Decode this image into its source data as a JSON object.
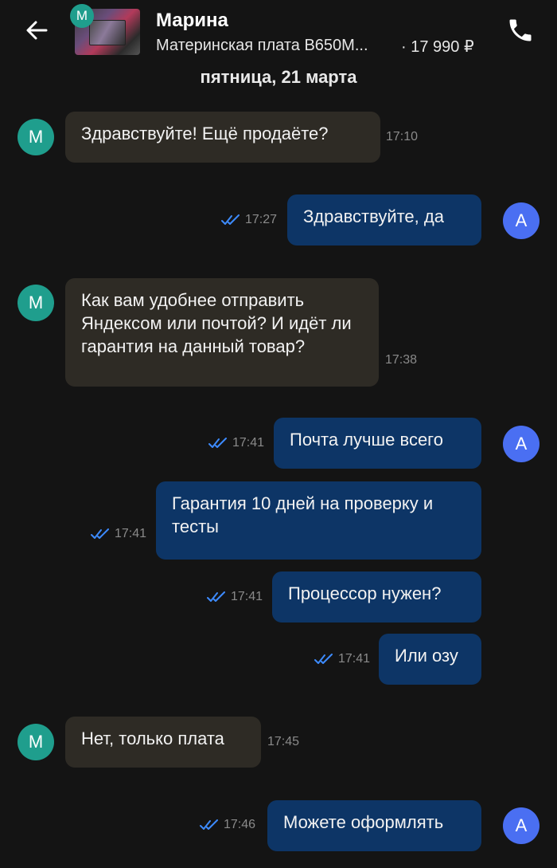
{
  "header": {
    "contact_name": "Марина",
    "contact_initial": "М",
    "product_title": "Материнская плата B650M...",
    "price": "· 17 990 ₽"
  },
  "date_separator": "пятница, 21 марта",
  "colors": {
    "background": "#141414",
    "incoming_bubble": "#2e2b25",
    "outgoing_bubble": "#0d3566",
    "avatar_contact": "#1f9e8d",
    "avatar_self": "#4a6ff2",
    "read_ticks": "#3d8bff"
  },
  "self_initial": "А",
  "messages": [
    {
      "direction": "in",
      "text": "Здравствуйте! Ещё продаёте?",
      "time": "17:10"
    },
    {
      "direction": "out",
      "text": "Здравствуйте, да",
      "time": "17:27",
      "status": "read"
    },
    {
      "direction": "in",
      "text": "Как вам удобнее отправить Яндексом или почтой? И идёт ли гарантия на данный товар?",
      "time": "17:38"
    },
    {
      "direction": "out",
      "text": "Почта лучше всего",
      "time": "17:41",
      "status": "read"
    },
    {
      "direction": "out",
      "text": "Гарантия 10 дней на проверку и тесты",
      "time": "17:41",
      "status": "read"
    },
    {
      "direction": "out",
      "text": "Процессор нужен?",
      "time": "17:41",
      "status": "read"
    },
    {
      "direction": "out",
      "text": "Или озу",
      "time": "17:41",
      "status": "read"
    },
    {
      "direction": "in",
      "text": "Нет, только плата",
      "time": "17:45"
    },
    {
      "direction": "out",
      "text": "Можете оформлять",
      "time": "17:46",
      "status": "read"
    }
  ]
}
